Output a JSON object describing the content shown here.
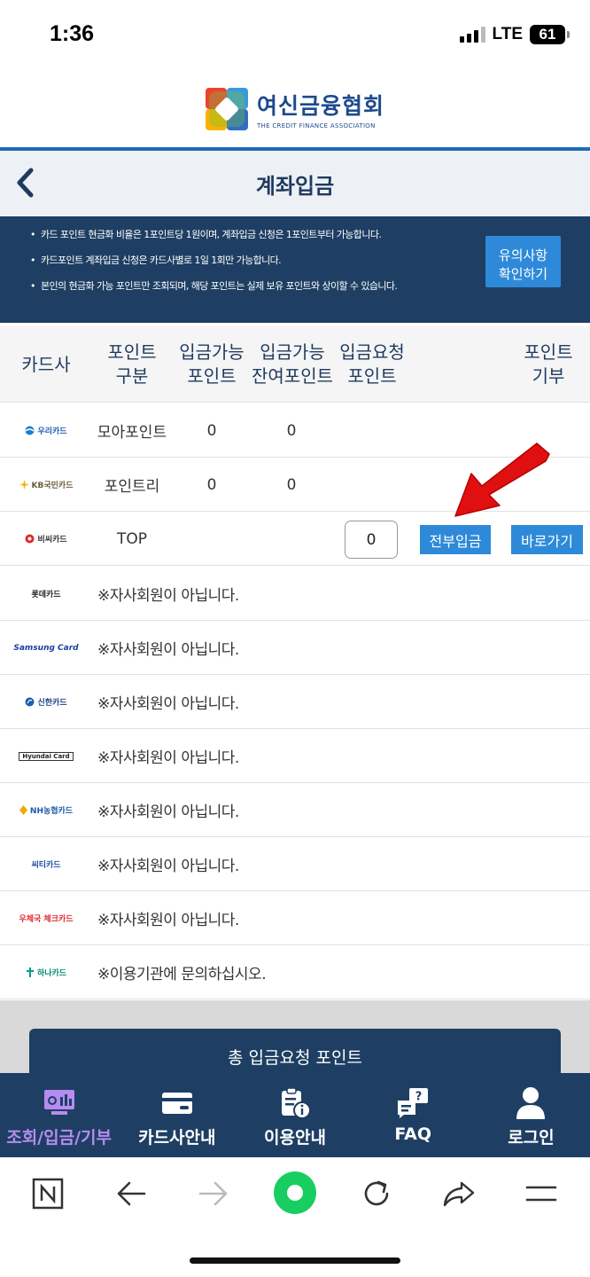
{
  "status_bar": {
    "time": "1:36",
    "network": "LTE",
    "battery": "61"
  },
  "header": {
    "logo_ko": "여신금융협회",
    "logo_en": "THE CREDIT FINANCE ASSOCIATION"
  },
  "titlebar": {
    "title": "계좌입금"
  },
  "notice": {
    "items": [
      "카드 포인트 현금화 비율은 1포인트당 1원이며, 계좌입금 신청은 1포인트부터 가능합니다.",
      "카드포인트 계좌입금 신청은 카드사별로 1일 1회만 가능합니다.",
      "본인의 현금화 가능 포인트만 조회되며, 해당 포인트는 실제 보유 포인트와 상이할 수 있습니다."
    ],
    "button_label": "유의사항\n확인하기"
  },
  "table": {
    "headers": [
      "카드사",
      "포인트\n구분",
      "입금가능\n포인트",
      "입금가능\n잔여포인트",
      "입금요청\n포인트",
      "포인트\n기부"
    ],
    "rows": [
      {
        "card": "우리카드",
        "point_type": "모아포인트",
        "available": "0",
        "remaining": "0"
      },
      {
        "card": "KB국민카드",
        "point_type": "포인트리",
        "available": "0",
        "remaining": "0"
      },
      {
        "card": "비씨카드",
        "point_type": "TOP",
        "available": "",
        "remaining": "",
        "request_value": "0",
        "deposit_all_label": "전부입금",
        "goto_label": "바로가기"
      },
      {
        "card": "롯데카드",
        "message": "※자사회원이 아닙니다."
      },
      {
        "card": "Samsung Card",
        "message": "※자사회원이 아닙니다."
      },
      {
        "card": "신한카드",
        "message": "※자사회원이 아닙니다."
      },
      {
        "card": "Hyundai Card",
        "message": "※자사회원이 아닙니다."
      },
      {
        "card": "NH농협카드",
        "message": "※자사회원이 아닙니다."
      },
      {
        "card": "씨티카드",
        "message": "※자사회원이 아닙니다."
      },
      {
        "card": "우체국 체크카드",
        "message": "※자사회원이 아닙니다."
      },
      {
        "card": "하나카드",
        "message": "※이용기관에 문의하십시오."
      }
    ]
  },
  "summary": {
    "label": "총 입금요청 포인트"
  },
  "bottom_nav": [
    {
      "label": "조회/입금/기부",
      "icon": "monitor-chart-icon",
      "active": true
    },
    {
      "label": "카드사안내",
      "icon": "card-icon"
    },
    {
      "label": "이용안내",
      "icon": "clipboard-info-icon"
    },
    {
      "label": "FAQ",
      "icon": "faq-chat-icon"
    },
    {
      "label": "로그인",
      "icon": "person-icon"
    }
  ],
  "colors": {
    "navy": "#1e3f63",
    "blue_button": "#2e8ad8",
    "title_text": "#1f3a5f",
    "active_nav": "#b58cf0",
    "arrow_red": "#e01010"
  }
}
